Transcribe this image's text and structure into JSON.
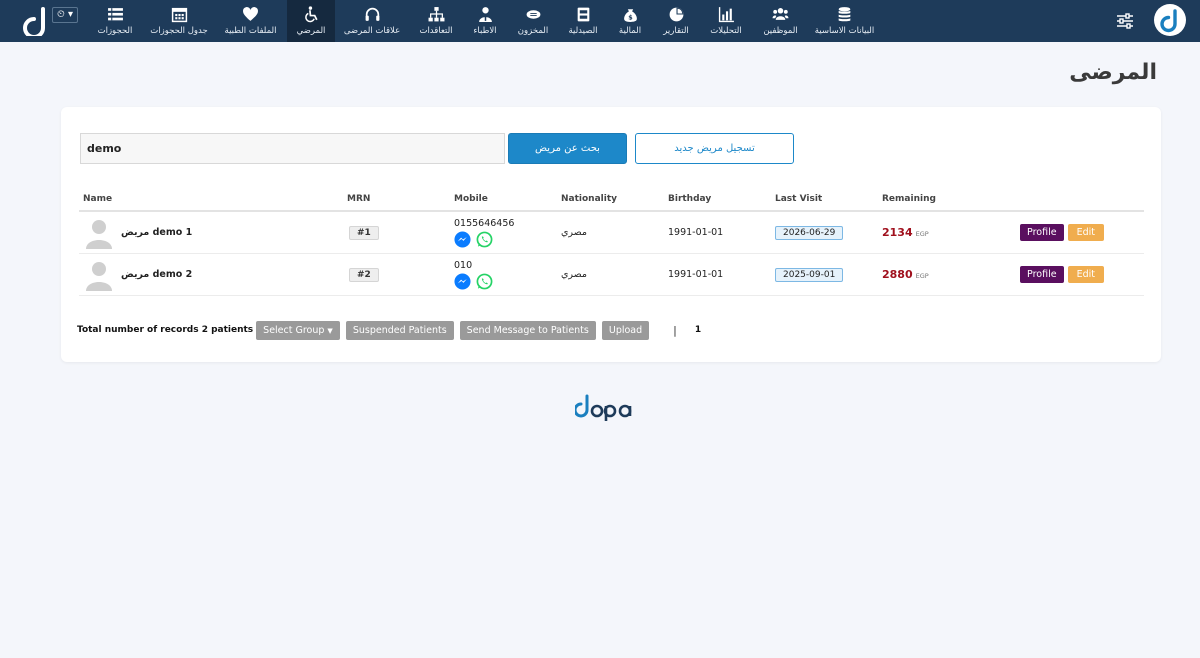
{
  "nav": {
    "items": [
      {
        "label": "الحجوزات",
        "icon": "list-icon"
      },
      {
        "label": "جدول الحجوزات",
        "icon": "calendar-icon"
      },
      {
        "label": "الملفات الطبية",
        "icon": "heart-icon"
      },
      {
        "label": "المرضي",
        "icon": "wheelchair-icon",
        "active": true
      },
      {
        "label": "علاقات المرضى",
        "icon": "headset-icon"
      },
      {
        "label": "التعاقدات",
        "icon": "sitemap-icon"
      },
      {
        "label": "الاطباء",
        "icon": "doctor-icon"
      },
      {
        "label": "المخزون",
        "icon": "pills-icon"
      },
      {
        "label": "الصيدلية",
        "icon": "medkit-icon"
      },
      {
        "label": "المالية",
        "icon": "money-bag-icon"
      },
      {
        "label": "التقارير",
        "icon": "pie-chart-icon"
      },
      {
        "label": "التحليلات",
        "icon": "bar-chart-icon"
      },
      {
        "label": "الموظفين",
        "icon": "users-icon"
      },
      {
        "label": "البيانات الاساسية",
        "icon": "database-icon"
      }
    ]
  },
  "page": {
    "title": "المرضى"
  },
  "search": {
    "value": "demo",
    "search_button": "بحث عن مريض",
    "new_button": "تسجيل مريض جديد"
  },
  "table": {
    "headers": [
      "Name",
      "MRN",
      "Mobile",
      "Nationality",
      "Birthday",
      "Last Visit",
      "Remaining"
    ],
    "rows": [
      {
        "name": "مريض demo 1",
        "mrn": "#1",
        "mobile": "0155646456",
        "nationality": "مصري",
        "birthday": "1991-01-01",
        "last_visit": "2026-06-29",
        "remaining": "2134",
        "currency": "EGP",
        "profile": "Profile",
        "edit": "Edit"
      },
      {
        "name": "مريض demo 2",
        "mrn": "#2",
        "mobile": "010",
        "nationality": "مصري",
        "birthday": "1991-01-01",
        "last_visit": "2025-09-01",
        "remaining": "2880",
        "currency": "EGP",
        "profile": "Profile",
        "edit": "Edit"
      }
    ]
  },
  "footer": {
    "total_text": "Total number of records 2 patients",
    "select_group": "Select Group",
    "suspended": "Suspended Patients",
    "send_message": "Send Message to Patients",
    "upload": "Upload",
    "separator": "|",
    "page": "1"
  },
  "colors": {
    "navbar": "#1e3b5a",
    "primary": "#1d88c9",
    "profile": "#5a0f5f",
    "edit": "#f0ad4e",
    "remaining": "#a0101d"
  }
}
